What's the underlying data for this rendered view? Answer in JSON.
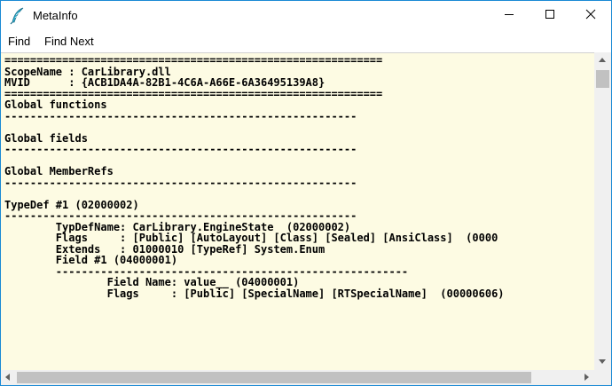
{
  "window": {
    "title": "MetaInfo"
  },
  "menu": {
    "items": [
      "Find",
      "Find Next"
    ]
  },
  "content": {
    "lines": [
      "===========================================================",
      "ScopeName : CarLibrary.dll",
      "MVID      : {ACB1DA4A-82B1-4C6A-A66E-6A36495139A8}",
      "===========================================================",
      "Global functions",
      "-------------------------------------------------------",
      "",
      "Global fields",
      "-------------------------------------------------------",
      "",
      "Global MemberRefs",
      "-------------------------------------------------------",
      "",
      "TypeDef #1 (02000002)",
      "-------------------------------------------------------",
      "        TypDefName: CarLibrary.EngineState  (02000002)",
      "        Flags     : [Public] [AutoLayout] [Class] [Sealed] [AnsiClass]  (0000",
      "        Extends   : 01000010 [TypeRef] System.Enum",
      "        Field #1 (04000001)",
      "        -------------------------------------------------------",
      "                Field Name: value__ (04000001)",
      "                Flags     : [Public] [SpecialName] [RTSpecialName]  (00000606)"
    ]
  },
  "colors": {
    "content_background": "#fdfbe3",
    "window_border": "#1a8ad4"
  }
}
